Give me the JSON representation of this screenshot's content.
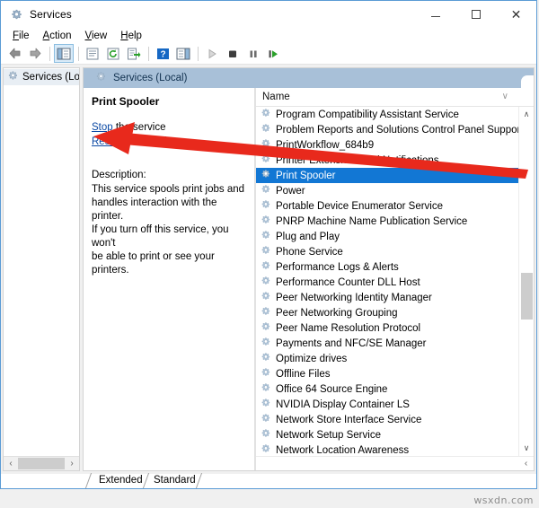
{
  "window": {
    "title": "Services",
    "title_icon": "services-gear-icon",
    "controls": {
      "minimize": "minimize-button",
      "maximize": "maximize-button",
      "close": "close-button"
    }
  },
  "menu": {
    "items": [
      {
        "label": "File",
        "accel": "F"
      },
      {
        "label": "Action",
        "accel": "A"
      },
      {
        "label": "View",
        "accel": "V"
      },
      {
        "label": "Help",
        "accel": "H"
      }
    ]
  },
  "toolbar": {
    "buttons": [
      {
        "name": "back-icon",
        "glyph": "back-arrow"
      },
      {
        "name": "forward-icon",
        "glyph": "forward-arrow"
      },
      {
        "name": "show-hide-console-tree-icon",
        "glyph": "tree-pane",
        "selected": true
      },
      {
        "name": "properties-icon",
        "glyph": "properties"
      },
      {
        "name": "refresh-icon",
        "glyph": "refresh"
      },
      {
        "name": "export-list-icon",
        "glyph": "export"
      },
      {
        "name": "help-icon",
        "glyph": "question"
      },
      {
        "name": "show-action-pane-icon",
        "glyph": "action-pane"
      },
      {
        "name": "start-service-icon",
        "glyph": "play"
      },
      {
        "name": "stop-service-icon",
        "glyph": "stop"
      },
      {
        "name": "pause-service-icon",
        "glyph": "pause"
      },
      {
        "name": "restart-service-icon",
        "glyph": "restart"
      }
    ]
  },
  "tree": {
    "item_label": "Services (Loca",
    "item_icon": "services-gear-icon",
    "hscroll": {
      "left_arrow": "‹",
      "right_arrow": "›"
    }
  },
  "pane": {
    "header_title": "Services (Local)",
    "header_icon": "services-gear-icon",
    "header_bg": "#a8c0d8"
  },
  "details": {
    "service_name": "Print Spooler",
    "actions": [
      {
        "link": "Stop",
        "rest": " the service"
      },
      {
        "link": "Restart",
        "rest": " the service"
      }
    ],
    "description_label": "Description:",
    "description_lines": [
      "This service spools print jobs and",
      "handles interaction with the printer.",
      "If you turn off this service, you won't",
      "be able to print or see your printers."
    ]
  },
  "list": {
    "column_header": "Name",
    "header_chevron": "∨",
    "selected_index": 4,
    "selection_color": "#1277d4",
    "row_icon": "service-gear-icon",
    "rows": [
      "Program Compatibility Assistant Service",
      "Problem Reports and Solutions Control Panel Support",
      "PrintWorkflow_684b9",
      "Printer Extensions and Notifications",
      "Print Spooler",
      "Power",
      "Portable Device Enumerator Service",
      "PNRP Machine Name Publication Service",
      "Plug and Play",
      "Phone Service",
      "Performance Logs & Alerts",
      "Performance Counter DLL Host",
      "Peer Networking Identity Manager",
      "Peer Networking Grouping",
      "Peer Name Resolution Protocol",
      "Payments and NFC/SE Manager",
      "Optimize drives",
      "Offline Files",
      "Office 64 Source Engine",
      "NVIDIA Display Container LS",
      "Network Store Interface Service",
      "Network Setup Service",
      "Network Location Awareness"
    ],
    "vscroll": {
      "up_arrow": "∧",
      "down_arrow": "∨"
    },
    "hscroll": {
      "left_arrow": "‹"
    }
  },
  "tabs": [
    {
      "label": "Extended",
      "active": false
    },
    {
      "label": "Standard",
      "active": true
    }
  ],
  "annotation": {
    "arrow_color": "#e8291c",
    "from": "Print Spooler row",
    "to": "Restart link"
  },
  "watermark": {
    "text": "wsxdn.com"
  }
}
